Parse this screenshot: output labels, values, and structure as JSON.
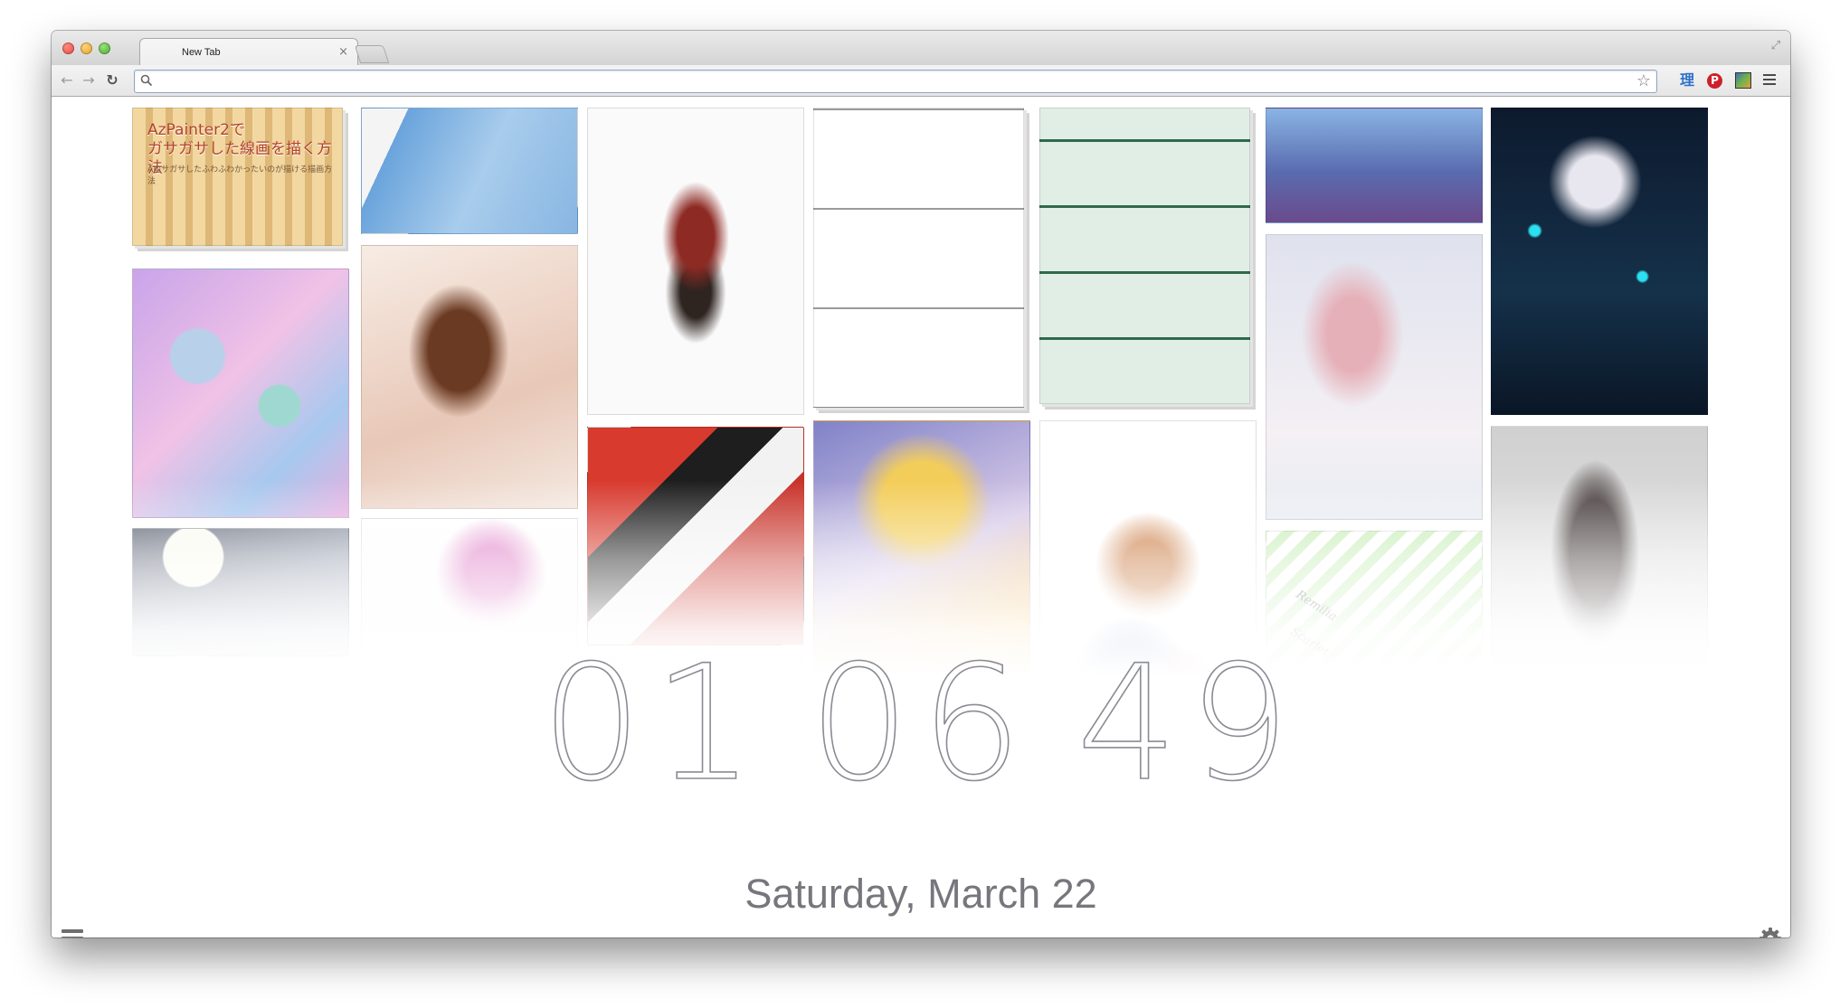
{
  "browser": {
    "tab_title": "New Tab",
    "tab_close": "×",
    "address": {
      "value": "",
      "placeholder": ""
    },
    "extensions": {
      "ri_label": "理",
      "pinterest_label": "P"
    }
  },
  "gallery": {
    "first_thumb_title": "AzPainter2で\nガサガサした線画を描く方法",
    "first_thumb_subtitle": "Aゆサガサしたふわふわかったいのが描ける描画方法",
    "remilia_caption": [
      "Remilia",
      "Scarlet"
    ]
  },
  "clock": {
    "hours": "01",
    "minutes": "06",
    "seconds": "49"
  },
  "date": "Saturday, March 22",
  "icons": {
    "page_menu": "menu-icon",
    "settings": "gear-icon"
  },
  "colors": {
    "clock_stroke": "#8a8a93",
    "date_text": "#76767d"
  }
}
